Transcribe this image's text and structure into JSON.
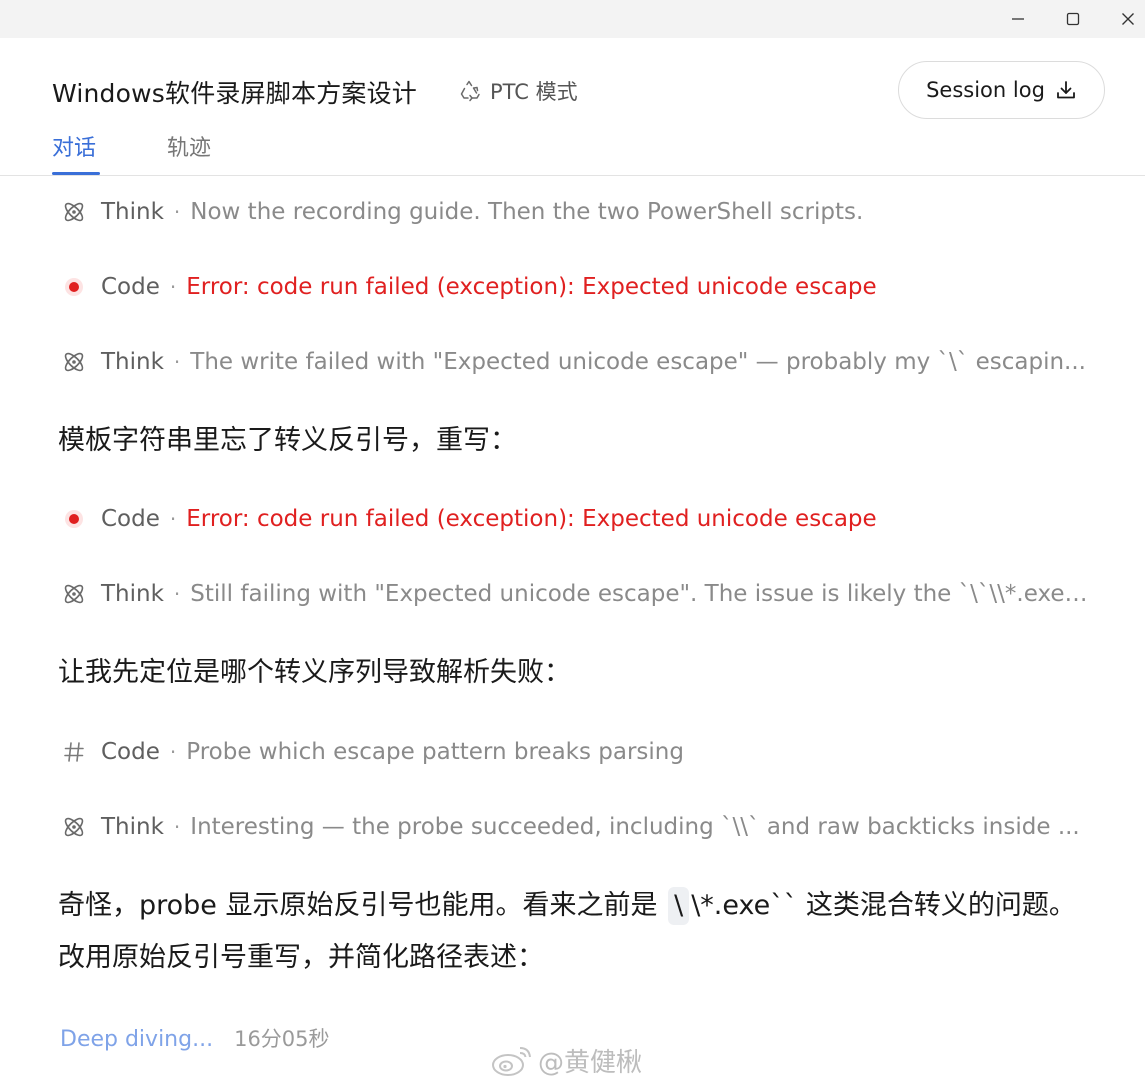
{
  "window": {
    "controls": [
      "minimize-icon",
      "maximize-icon",
      "close-icon"
    ]
  },
  "header": {
    "title": "Windows软件录屏脚本方案设计",
    "mode_label": "PTC 模式",
    "session_button": "Session log",
    "tabs": [
      {
        "label": "对话",
        "active": true
      },
      {
        "label": "轨迹",
        "active": false
      }
    ]
  },
  "colors": {
    "accent": "#3a6fd8",
    "error": "#e02020",
    "muted": "#8a8a8a"
  },
  "feed": [
    {
      "type": "step",
      "kind": "Think",
      "icon": "atom-icon",
      "separator": "·",
      "text": "Now the recording guide. Then the two PowerShell scripts.",
      "error": false
    },
    {
      "type": "step",
      "kind": "Code",
      "icon": "error-dot-icon",
      "separator": "·",
      "text": "Error: code run failed (exception): Expected unicode escape",
      "error": true
    },
    {
      "type": "step",
      "kind": "Think",
      "icon": "atom-icon",
      "separator": "·",
      "text": "The write failed with \"Expected unicode escape\" — probably my `\\` escapin...",
      "error": false
    },
    {
      "type": "message",
      "text": "模板字符串里忘了转义反引号，重写："
    },
    {
      "type": "step",
      "kind": "Code",
      "icon": "error-dot-icon",
      "separator": "·",
      "text": "Error: code run failed (exception): Expected unicode escape",
      "error": true
    },
    {
      "type": "step",
      "kind": "Think",
      "icon": "atom-icon",
      "separator": "·",
      "text": "Still failing with \"Expected unicode escape\". The issue is likely the `\\`\\\\*.exe\\...",
      "error": false
    },
    {
      "type": "message",
      "text": "让我先定位是哪个转义序列导致解析失败："
    },
    {
      "type": "step",
      "kind": "Code",
      "icon": "hash-icon",
      "separator": "·",
      "text": "Probe which escape pattern breaks parsing",
      "error": false
    },
    {
      "type": "step",
      "kind": "Think",
      "icon": "atom-icon",
      "separator": "·",
      "text": "Interesting — the probe succeeded, including `\\\\` and raw backticks inside ...",
      "error": false
    }
  ],
  "final_message": {
    "before": "奇怪，probe 显示原始反引号也能用。看来之前是 ",
    "code": "\\",
    "after": "\\*.exe`` 这类混合转义的问题。改用原始反引号重写，并简化路径表述："
  },
  "status": {
    "label": "Deep diving...",
    "elapsed": "16分05秒"
  },
  "watermark": {
    "text": "@黄健楸",
    "icon": "weibo-icon"
  }
}
